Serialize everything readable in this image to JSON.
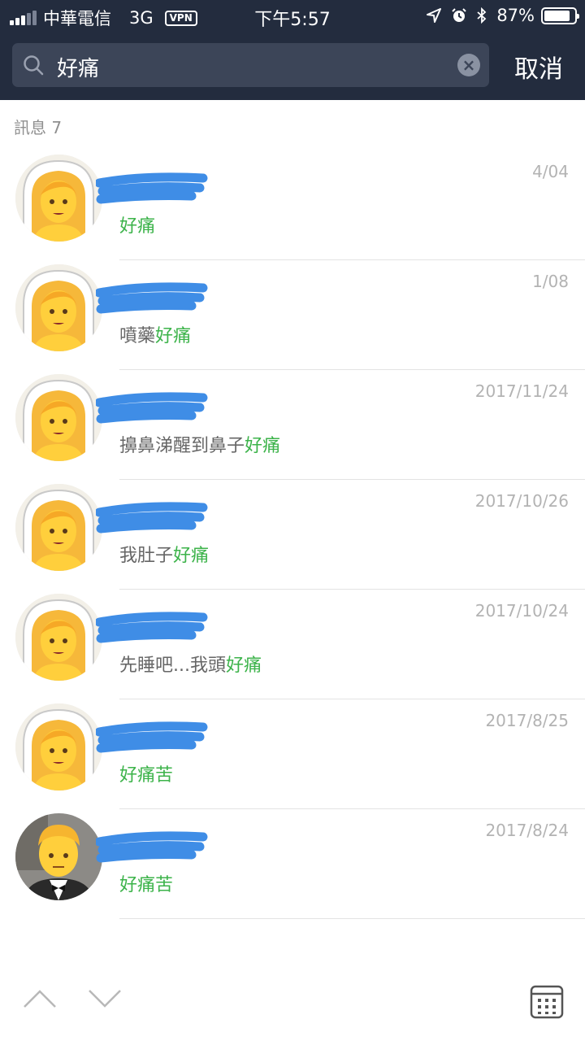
{
  "status_bar": {
    "carrier": "中華電信",
    "network": "3G",
    "vpn": "VPN",
    "time": "下午5:57",
    "battery": "87%",
    "battery_level": 0.87
  },
  "search": {
    "query": "好痛",
    "cancel_label": "取消"
  },
  "results": {
    "section_label": "訊息 7",
    "items": [
      {
        "date": "4/04",
        "pre": "",
        "hl": "好痛",
        "post": "",
        "avatar": "bride-emoji"
      },
      {
        "date": "1/08",
        "pre": "噴藥",
        "hl": "好痛",
        "post": "",
        "avatar": "bride-emoji"
      },
      {
        "date": "2017/11/24",
        "pre": "擤鼻涕醒到鼻子",
        "hl": "好痛",
        "post": "",
        "avatar": "bride-emoji"
      },
      {
        "date": "2017/10/26",
        "pre": "我肚子",
        "hl": "好痛",
        "post": "",
        "avatar": "bride-emoji"
      },
      {
        "date": "2017/10/24",
        "pre": "先睡吧...我頭",
        "hl": "好痛",
        "post": "",
        "avatar": "bride-emoji"
      },
      {
        "date": "2017/8/25",
        "pre": "",
        "hl": "好痛",
        "post": "苦",
        "avatar": "bride-emoji"
      },
      {
        "date": "2017/8/24",
        "pre": "",
        "hl": "好痛",
        "post": "苦",
        "avatar": "groom-emoji"
      }
    ]
  },
  "colors": {
    "header_bg": "#232c3e",
    "search_bg": "#3c4558",
    "highlight": "#3cb34a",
    "scribble": "#3f8de6"
  },
  "bottom_bar": {
    "icons": [
      "chevron-up-icon",
      "chevron-down-icon",
      "calendar-icon"
    ]
  }
}
